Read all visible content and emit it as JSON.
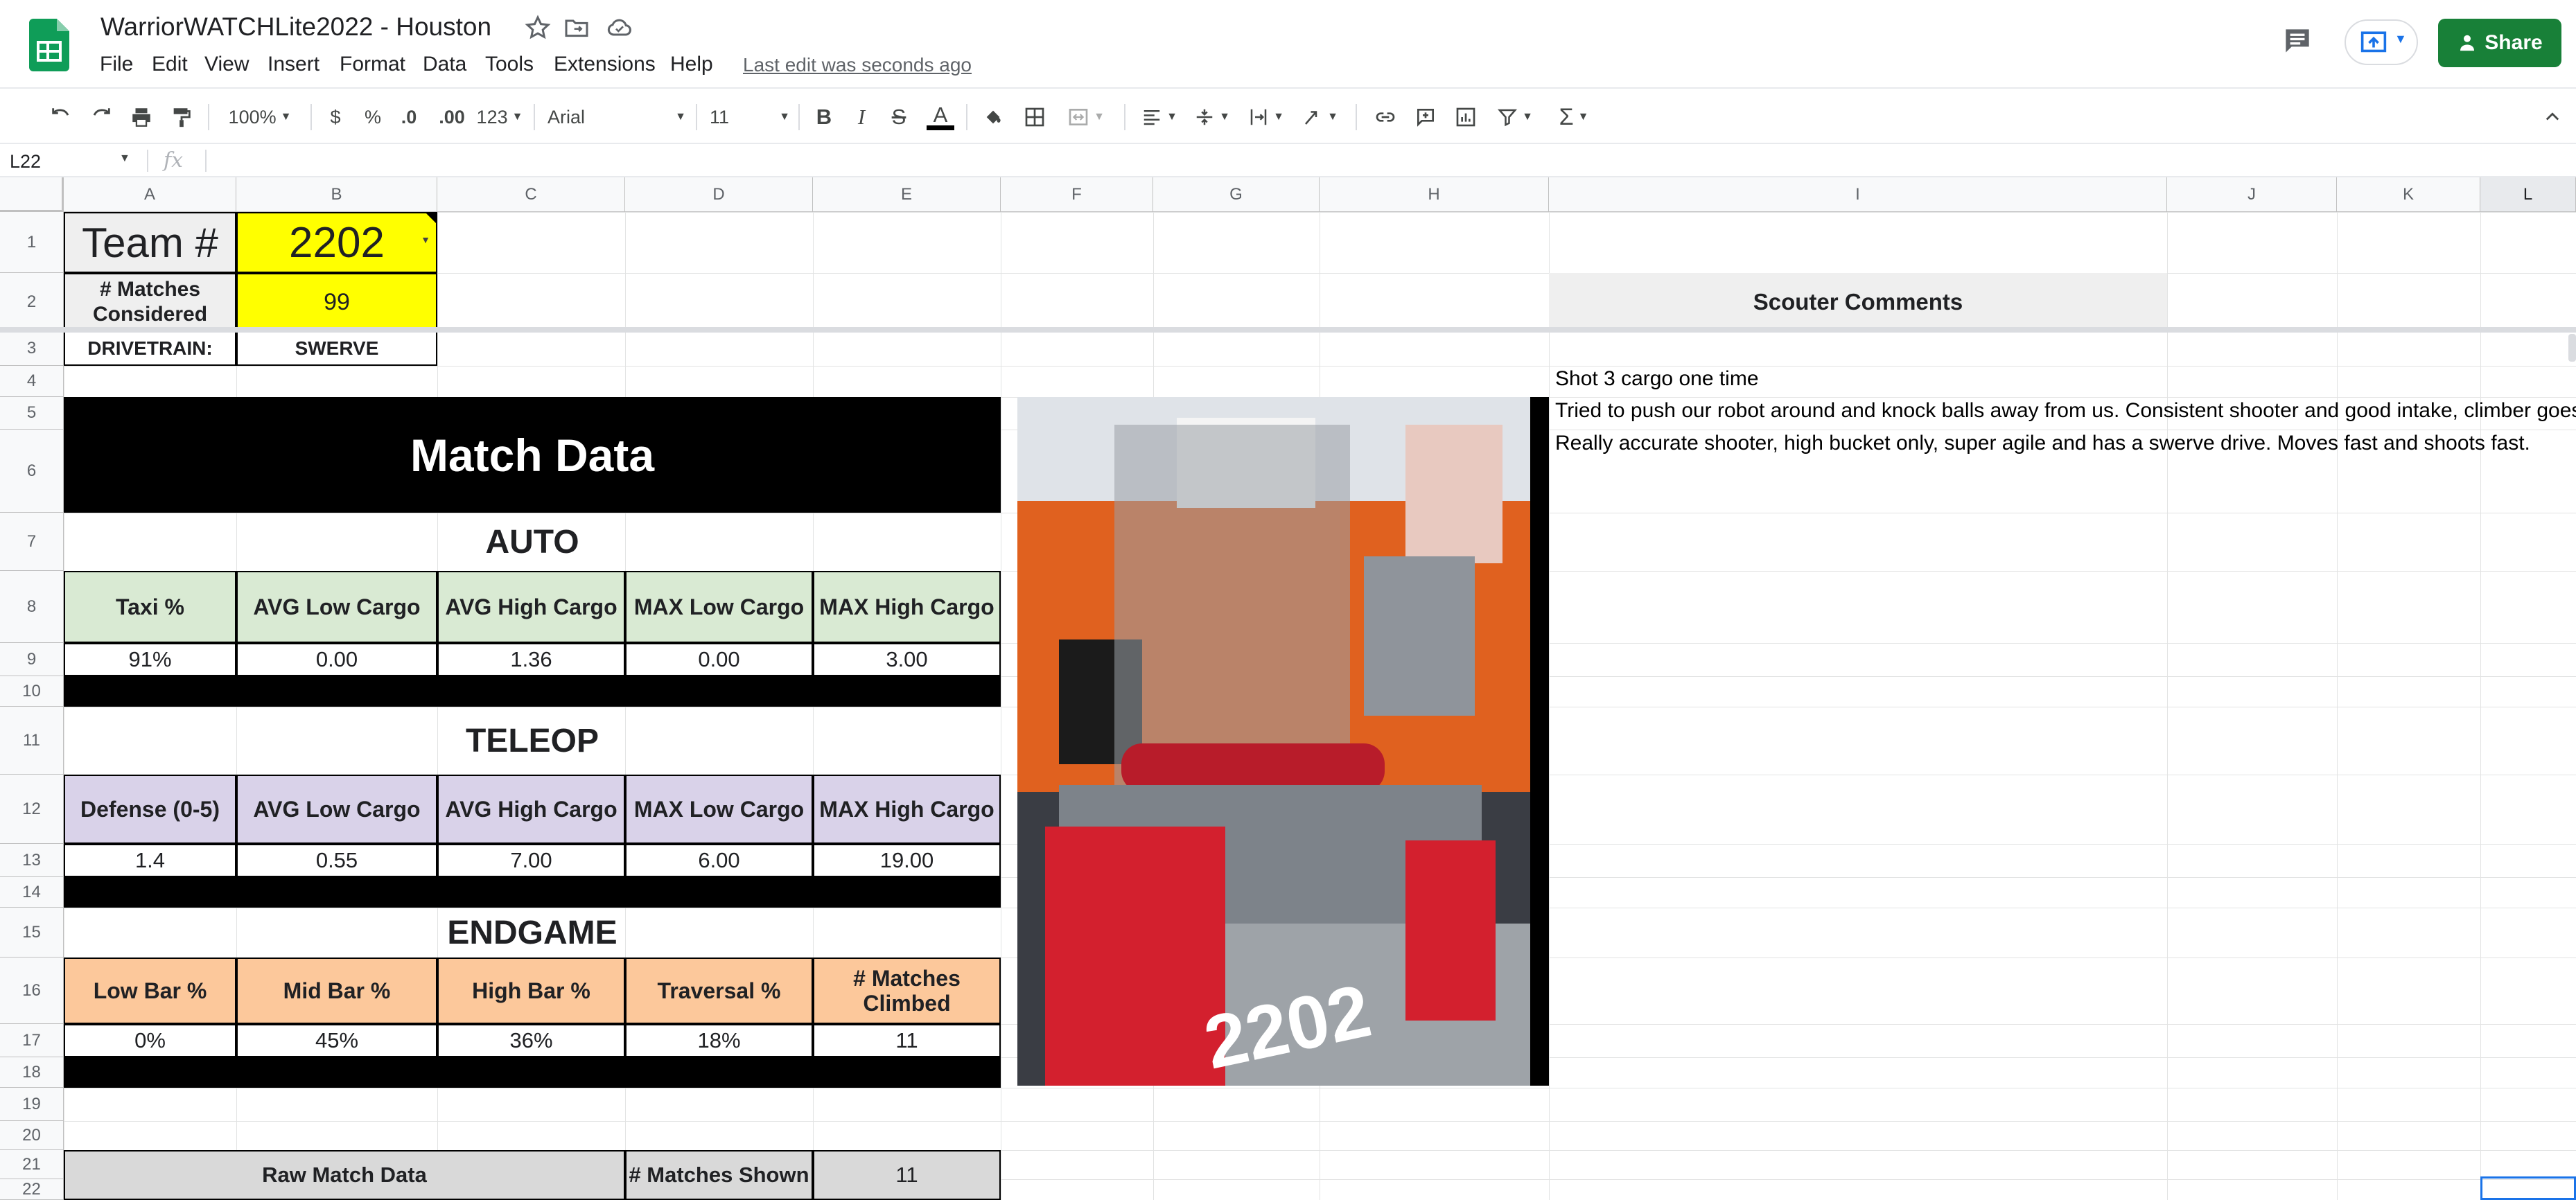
{
  "app": {
    "title": "WarriorWATCHLite2022 - Houston",
    "last_edit": "Last edit was seconds ago",
    "share_label": "Share"
  },
  "menu": [
    "File",
    "Edit",
    "View",
    "Insert",
    "Format",
    "Data",
    "Tools",
    "Extensions",
    "Help"
  ],
  "toolbar": {
    "zoom": "100%",
    "currency": "$",
    "percent": "%",
    "dec_less": ".0",
    "dec_more": ".00",
    "number_format": "123",
    "font": "Arial",
    "font_size": "11"
  },
  "formula_bar": {
    "name_box": "L22",
    "fx": "fx",
    "content": ""
  },
  "columns": [
    "A",
    "B",
    "C",
    "D",
    "E",
    "F",
    "G",
    "H",
    "I",
    "J",
    "K",
    "L"
  ],
  "rows": [
    "1",
    "2",
    "3",
    "4",
    "5",
    "6",
    "7",
    "8",
    "9",
    "10",
    "11",
    "12",
    "13",
    "14",
    "15",
    "16",
    "17",
    "18",
    "19",
    "20",
    "21",
    "22"
  ],
  "sheet": {
    "team_label": "Team #",
    "team_number": "2202",
    "matches_label": "# Matches Considered",
    "matches_value": "99",
    "drivetrain_label": "DRIVETRAIN:",
    "drivetrain_value": "SWERVE",
    "match_data_title": "Match Data",
    "auto": {
      "title": "AUTO",
      "headers": [
        "Taxi %",
        "AVG Low Cargo",
        "AVG High Cargo",
        "MAX Low Cargo",
        "MAX High Cargo"
      ],
      "values": [
        "91%",
        "0.00",
        "1.36",
        "0.00",
        "3.00"
      ]
    },
    "teleop": {
      "title": "TELEOP",
      "headers": [
        "Defense (0-5)",
        "AVG Low Cargo",
        "AVG High Cargo",
        "MAX Low Cargo",
        "MAX High Cargo"
      ],
      "values": [
        "1.4",
        "0.55",
        "7.00",
        "6.00",
        "19.00"
      ]
    },
    "endgame": {
      "title": "ENDGAME",
      "headers": [
        "Low Bar %",
        "Mid Bar %",
        "High Bar %",
        "Traversal %",
        "# Matches Climbed"
      ],
      "values": [
        "0%",
        "45%",
        "36%",
        "18%",
        "11"
      ]
    },
    "raw_label": "Raw Match Data",
    "matches_shown_label": "# Matches Shown",
    "matches_shown_value": "11",
    "scouter_comments_label": "Scouter Comments",
    "comments": [
      "Shot  3 cargo one time",
      "Tried to push our robot around and knock balls away from us. Consistent shooter and good intake, climber goes",
      "Really accurate shooter, high bucket only, super agile and has a swerve drive. Moves fast and shoots fast."
    ],
    "robot_number": "2202"
  },
  "colors": {
    "yellow": "#ffff00",
    "green_hdr": "#d9ead3",
    "purple_hdr": "#d9d2e9",
    "orange_hdr": "#fcc89b",
    "gray_hdr": "#d9d9d9",
    "comments_hdr": "#efefef",
    "share": "#188038"
  }
}
